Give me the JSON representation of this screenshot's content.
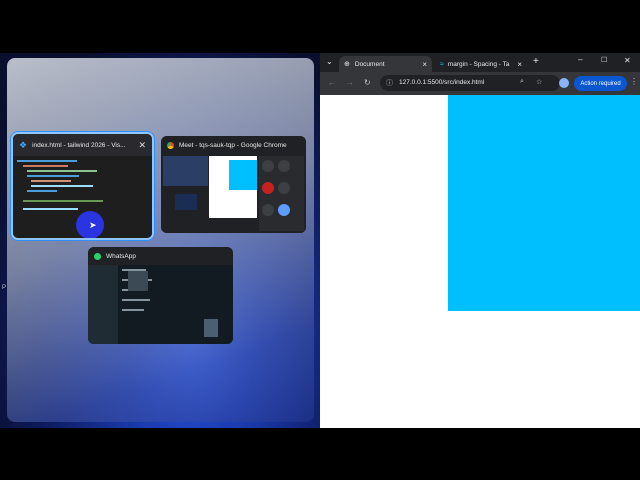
{
  "snap": {
    "windows": [
      {
        "title": "index.html - tailwind 2026 - Vis...",
        "close": "✕",
        "icon": "vscode-icon"
      },
      {
        "title": "Meet - tqs-sauk-tqp - Google Chrome",
        "icon": "chrome-icon"
      },
      {
        "title": "WhatsApp",
        "icon": "whatsapp-icon"
      }
    ]
  },
  "browser": {
    "tabs": [
      {
        "label": "Document",
        "close": "×"
      },
      {
        "label": "margin - Spacing - Ta",
        "close": "×"
      }
    ],
    "new_tab": "+",
    "url": "127.0.0.1:5500/src/index.html",
    "action_required": "Action required",
    "page_box_color": "#00bfff"
  },
  "colors": {
    "accent": "#2f8fff",
    "chrome_dark": "#202124",
    "cyan": "#00bfff"
  }
}
